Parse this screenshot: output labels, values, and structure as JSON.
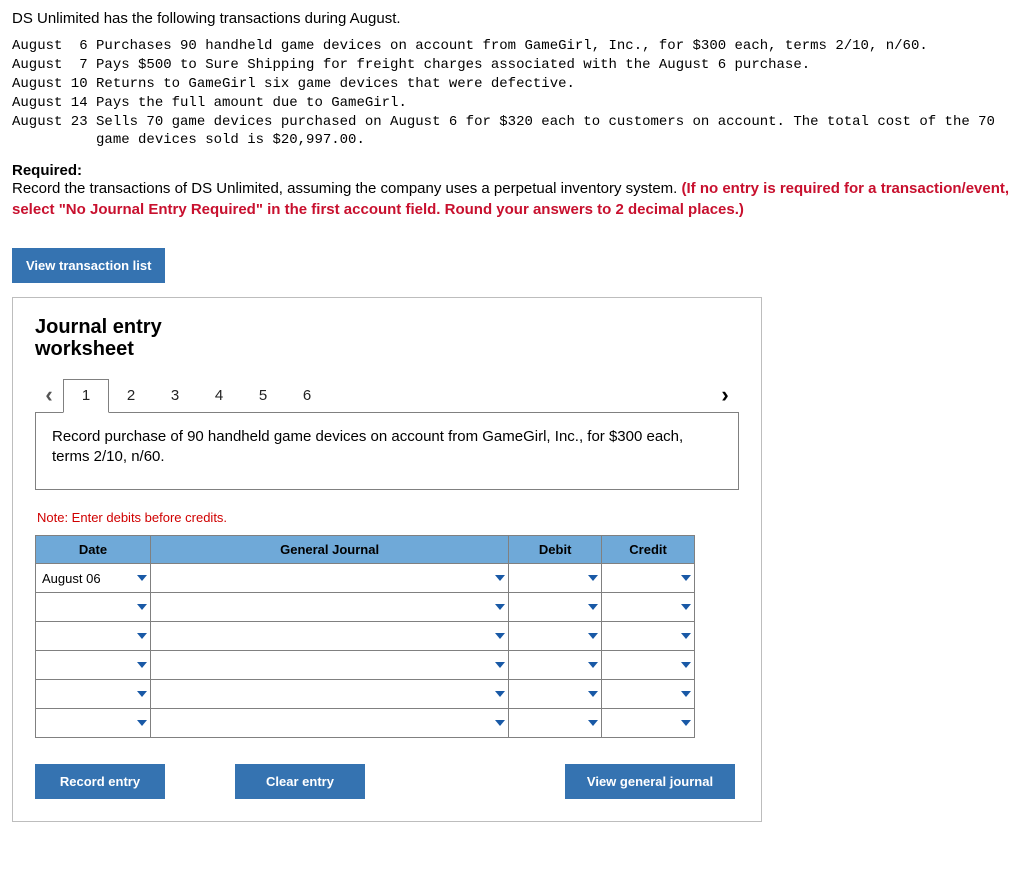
{
  "intro": "DS Unlimited has the following transactions during August.",
  "transactions_block": "August  6 Purchases 90 handheld game devices on account from GameGirl, Inc., for $300 each, terms 2/10, n/60.\nAugust  7 Pays $500 to Sure Shipping for freight charges associated with the August 6 purchase.\nAugust 10 Returns to GameGirl six game devices that were defective.\nAugust 14 Pays the full amount due to GameGirl.\nAugust 23 Sells 70 game devices purchased on August 6 for $320 each to customers on account. The total cost of the 70\n          game devices sold is $20,997.00.",
  "required_label": "Required:",
  "required_text": "Record the transactions of DS Unlimited, assuming the company uses a perpetual inventory system. ",
  "required_red": "(If no entry is required for a transaction/event, select \"No Journal Entry Required\" in the first account field. Round your answers to 2 decimal places.)",
  "view_transaction_list": "View transaction list",
  "worksheet": {
    "title_line1": "Journal entry",
    "title_line2": "worksheet",
    "tabs": [
      "1",
      "2",
      "3",
      "4",
      "5",
      "6"
    ],
    "instruction": "Record purchase of 90 handheld game devices on account from GameGirl, Inc., for $300 each, terms 2/10, n/60.",
    "note": "Note: Enter debits before credits.",
    "headers": {
      "date": "Date",
      "gj": "General Journal",
      "debit": "Debit",
      "credit": "Credit"
    },
    "first_date": "August 06",
    "buttons": {
      "record": "Record entry",
      "clear": "Clear entry",
      "view_gj": "View general journal"
    }
  }
}
